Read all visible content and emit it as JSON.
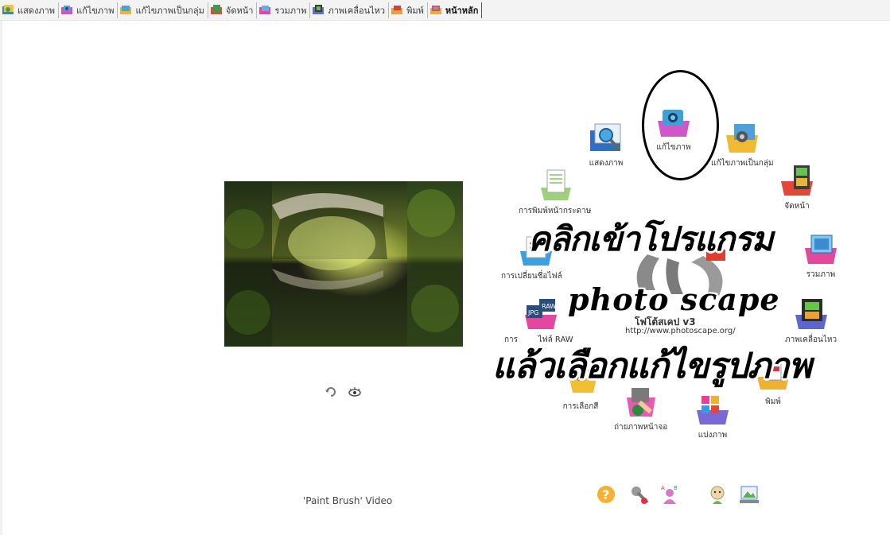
{
  "tabs": [
    {
      "id": "viewer",
      "label": "แสดงภาพ",
      "icon": "viewer-icon",
      "active": false
    },
    {
      "id": "editor",
      "label": "แก้ไขภาพ",
      "icon": "editor-icon",
      "active": false
    },
    {
      "id": "batch",
      "label": "แก้ไขภาพเป็นกลุ่ม",
      "icon": "batch-editor-icon",
      "active": false
    },
    {
      "id": "page",
      "label": "จัดหน้า",
      "icon": "page-icon",
      "active": false
    },
    {
      "id": "combine",
      "label": "รวมภาพ",
      "icon": "combine-icon",
      "active": false
    },
    {
      "id": "gif",
      "label": "ภาพเคลื่อนไหว",
      "icon": "animated-gif-icon",
      "active": false
    },
    {
      "id": "print",
      "label": "พิมพ์",
      "icon": "print-icon",
      "active": false
    },
    {
      "id": "home",
      "label": "หน้าหลัก",
      "icon": "home-icon",
      "active": true
    }
  ],
  "center": {
    "caption": "'Paint Brush' Video"
  },
  "launcher": {
    "app_name": "โฟโต้สเคป v3",
    "app_url": "http://www.photoscape.org/",
    "items": {
      "viewer": "แสดงภาพ",
      "editor": "แก้ไขภาพ",
      "batch": "แก้ไขภาพเป็นกลุ่ม",
      "page": "จัดหน้า",
      "combine": "รวมภาพ",
      "gif": "ภาพเคลื่อนไหว",
      "print": "พิมพ์",
      "splitter": "แบ่งภาพ",
      "screen": "ถ่ายภาพหน้าจอ",
      "color": "การเลือกสี",
      "raw_prefix": "การ",
      "raw_suffix": "ไฟล์ RAW",
      "rename": "การเปลี่ยนชื่อไฟล์",
      "paper": "การพิมพ์หน้ากระดาษ"
    }
  },
  "overlay": {
    "line1": "คลิกเข้าโปรแกรม",
    "line2": "photo scape",
    "line3": "แล้วเลือกแก้ไขรูปภาพ"
  },
  "colors": {
    "tabbar_bg": "#f3f3f3",
    "highlight": "#000000",
    "logo_red": "#e43b2c",
    "logo_gray": "#7a7a7a"
  }
}
